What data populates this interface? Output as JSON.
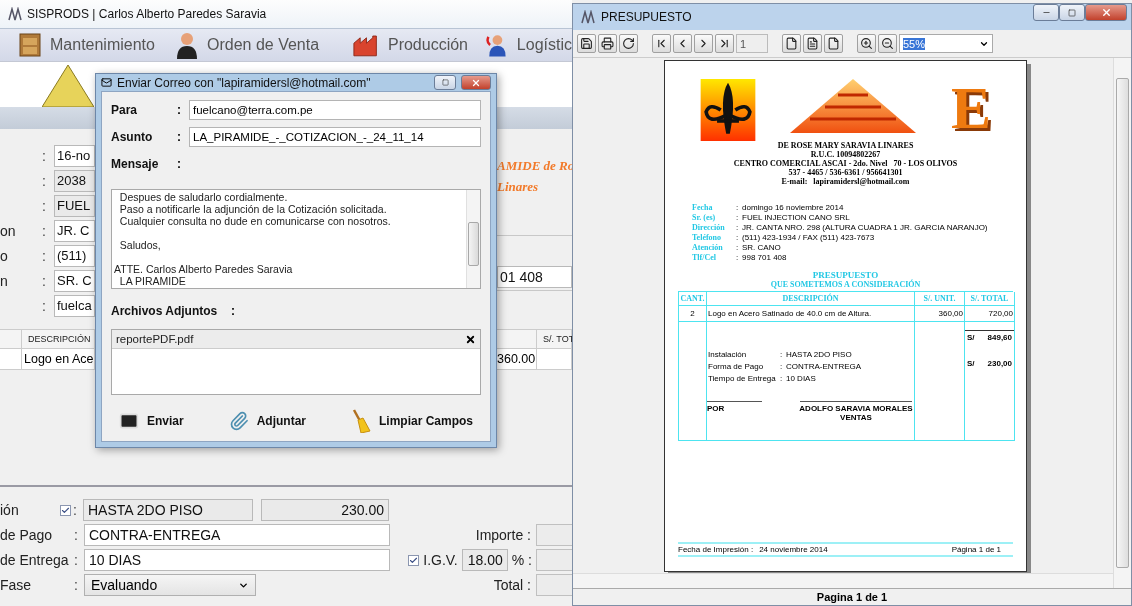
{
  "main_window": {
    "title": "SISPRODS | Carlos Alberto Paredes Saravia",
    "menu": [
      {
        "label": "Mantenimiento"
      },
      {
        "label": "Orden de Venta"
      },
      {
        "label": "Producción"
      },
      {
        "label": "Logístic"
      }
    ],
    "form_rows": [
      {
        "sep": ":",
        "value": "16-no"
      },
      {
        "sep": ":",
        "value": "2038"
      },
      {
        "sep": ":",
        "value": "FUEL"
      },
      {
        "label": "on",
        "sep": ":",
        "value": "JR. C"
      },
      {
        "label": "o",
        "sep": ":",
        "value": "(511)"
      },
      {
        "label": "n",
        "sep": ":",
        "value": "SR. C"
      },
      {
        "sep": ":",
        "value": "fuelca"
      }
    ],
    "company_fragment": [
      "AMIDE de Ro",
      "Linares"
    ],
    "phone_fragment": "01 408",
    "table": {
      "columns": [
        "DESCRIPCIÓN",
        "S/. TOT"
      ],
      "rows": [
        {
          "description": "Logo en Ace",
          "amount": "360.00"
        }
      ]
    },
    "bottom_rows": [
      {
        "kind": "check",
        "label": "ión",
        "sep": ":",
        "checked": true,
        "value": "HASTA 2DO PISO",
        "amount": "230.00"
      },
      {
        "kind": "text",
        "label": "de Pago",
        "sep": ":",
        "value": "CONTRA-ENTREGA"
      },
      {
        "kind": "text",
        "label": "de Entrega",
        "sep": ":",
        "value": "10 DIAS"
      },
      {
        "kind": "select",
        "label": "Fase",
        "sep": ":",
        "value": "Evaluando"
      }
    ],
    "totals": [
      {
        "kind": "plain",
        "label": "Importe :"
      },
      {
        "kind": "igv",
        "label": "I.G.V.",
        "checked": true,
        "value": "18.00",
        "unit": "% :"
      },
      {
        "kind": "plain",
        "label": "Total :"
      }
    ]
  },
  "email_dialog": {
    "title": "Enviar Correo con \"lapiramidersl@hotmail.com\"",
    "fields": [
      {
        "label": "Para",
        "sep": ":",
        "value": "fuelcano@terra.com.pe"
      },
      {
        "label": "Asunto",
        "sep": ":",
        "value": "LA_PIRAMIDE_-_COTIZACION_-_24_11_14"
      }
    ],
    "message_label": "Mensaje",
    "message_sep": ":",
    "message": "  Despues de saludarlo cordialmente.\n  Paso a notificarle la adjunción de la Cotización solicitada.\n  Cualquier consulta no dude en comunicarse con nosotros.\n\n  Saludos,\n\nATTE. Carlos Alberto Paredes Saravia\n  LA PIRAMIDE",
    "attachments_label": "Archivos Adjuntos",
    "attachments_sep": ":",
    "attachments": [
      {
        "name": "reportePDF.pdf"
      }
    ],
    "buttons": [
      {
        "label": "Enviar"
      },
      {
        "label": "Adjuntar"
      },
      {
        "label": "Limpiar Campos"
      }
    ]
  },
  "preview_window": {
    "title": "PRESUPUESTO",
    "page_field": "1",
    "zoom": "55%",
    "report": {
      "logo_letter": "E",
      "company": [
        "DE ROSE MARY SARAVIA LINARES",
        "R.U.C. 10094802267",
        "CENTRO COMERCIAL ASCAI - 2do. Nivel   70 - LOS OLIVOS",
        "537 - 4465 / 536-6361 / 956641301",
        "E-mail:   lapiramidersl@hotmail.com"
      ],
      "info": [
        {
          "label": "Fecha",
          "sep": ":",
          "value": "domingo 16 noviembre 2014"
        },
        {
          "label": "Sr. (es)",
          "sep": ":",
          "value": "FUEL INJECTION CANO SRL"
        },
        {
          "label": "Dirección",
          "sep": ":",
          "value": "JR. CANTA NRO. 298 (ALTURA CUADRA 1 JR. GARCIA NARANJO)"
        },
        {
          "label": "Teléfono",
          "sep": ":",
          "value": "(511) 423-1934 / FAX (511) 423-7673"
        },
        {
          "label": "Atención",
          "sep": ":",
          "value": "SR. CANO"
        },
        {
          "label": "Tlf/Cel",
          "sep": ":",
          "value": "998 701 408"
        }
      ],
      "heading": [
        "PRESUPUESTO",
        "QUE SOMETEMOS A CONSIDERACIÓN"
      ],
      "columns": [
        "CANT.",
        "DESCRIPCIÓN",
        "S/. UNIT.",
        "S/. TOTAL"
      ],
      "items": [
        {
          "qty": "2",
          "description": "Logo en Acero Satinado de 40.0 cm de Altura.",
          "unit": "360,00",
          "total": "720,00"
        }
      ],
      "subtotals": [
        {
          "currency": "S/",
          "amount": "849,60"
        },
        {
          "currency": "S/",
          "amount": "230,00"
        }
      ],
      "terms": [
        {
          "label": "Instalación",
          "sep": ":",
          "value": "HASTA 2DO PISO"
        },
        {
          "label": "Forma de Pago",
          "sep": ":",
          "value": "CONTRA-ENTREGA"
        },
        {
          "label": "Tiempo de Entrega",
          "sep": ":",
          "value": "10 DIAS"
        }
      ],
      "signatures": [
        {
          "name": "POR"
        },
        {
          "name": "ADOLFO SARAVIA MORALES",
          "role": "VENTAS"
        }
      ],
      "footer": {
        "label": "Fecha de Impresión :",
        "date": "24 noviembre 2014",
        "page": "Página 1 de 1"
      }
    },
    "status": "Pagina 1 de 1"
  }
}
